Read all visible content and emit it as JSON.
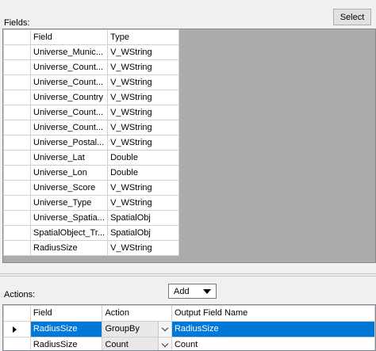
{
  "select_button": "Select",
  "fields_label": "Fields:",
  "fields_columns": [
    "Field",
    "Type"
  ],
  "fields_rows": [
    {
      "field": "Universe_Munic...",
      "type": "V_WString"
    },
    {
      "field": "Universe_Count...",
      "type": "V_WString"
    },
    {
      "field": "Universe_Count...",
      "type": "V_WString"
    },
    {
      "field": "Universe_Country",
      "type": "V_WString"
    },
    {
      "field": "Universe_Count...",
      "type": "V_WString"
    },
    {
      "field": "Universe_Count...",
      "type": "V_WString"
    },
    {
      "field": "Universe_Postal...",
      "type": "V_WString"
    },
    {
      "field": "Universe_Lat",
      "type": "Double"
    },
    {
      "field": "Universe_Lon",
      "type": "Double"
    },
    {
      "field": "Universe_Score",
      "type": "V_WString"
    },
    {
      "field": "Universe_Type",
      "type": "V_WString"
    },
    {
      "field": "Universe_Spatia...",
      "type": "SpatialObj"
    },
    {
      "field": "SpatialObject_Tr...",
      "type": "SpatialObj"
    },
    {
      "field": "RadiusSize",
      "type": "V_WString"
    }
  ],
  "add_button": "Add",
  "actions_label": "Actions:",
  "actions_columns": [
    "Field",
    "Action",
    "Output Field Name"
  ],
  "actions_rows": [
    {
      "field": "RadiusSize",
      "action": "GroupBy",
      "output": "RadiusSize",
      "selected": true
    },
    {
      "field": "RadiusSize",
      "action": "Count",
      "output": "Count",
      "selected": false
    }
  ],
  "colors": {
    "selection": "#0078d7",
    "grid_background": "#ababab"
  }
}
